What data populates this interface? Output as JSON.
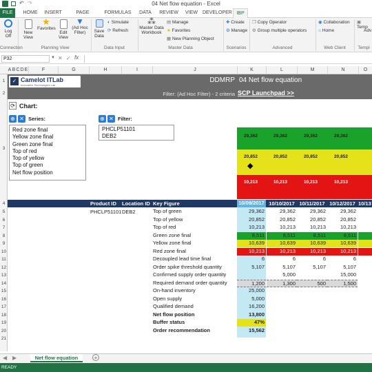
{
  "window": {
    "title": "04 Net flow equation - Excel"
  },
  "ribbon_tabs": [
    "FILE",
    "HOME",
    "INSERT",
    "PAGE LAYOUT",
    "FORMULAS",
    "DATA",
    "REVIEW",
    "VIEW",
    "DEVELOPER",
    "IBP"
  ],
  "ribbon": {
    "log_off": "Log Off",
    "new_view": "New View",
    "favorites": "Favorites",
    "edit_view": "Edit View",
    "ad_hoc": "(Ad Hoc Filter)",
    "save_data": "Save Data",
    "simulate": "Simulate",
    "refresh": "Refresh",
    "master_data_workbook": "Master Data Workbook",
    "manage": "Manage",
    "favorites2": "Favorites",
    "new_planning_object": "New Planning Object",
    "create": "Create",
    "manage2": "Manage",
    "copy_operator": "Copy Operator",
    "group_multiple": "Group multiple operators",
    "collaboration": "Collaboration",
    "home": "Home",
    "templates": "Temp",
    "adv": "Adv",
    "groups": [
      "Connection",
      "Planning View",
      "Data Input",
      "Master Data",
      "Scenarios",
      "Advanced",
      "Web Client",
      "Templ"
    ]
  },
  "formula_bar": {
    "name_box": "P32",
    "fx": "fx",
    "value": ""
  },
  "columns": [
    "A",
    "B",
    "C",
    "D",
    "E",
    "F",
    "G",
    "H",
    "I",
    "J",
    "K",
    "L",
    "M",
    "N",
    "O"
  ],
  "sheet": {
    "logo_name": "Camelot ITLab",
    "logo_sub": "Innovative Technologies Lab",
    "ddmrp": "DDMRP",
    "title": "04 Net flow equation",
    "filter_text": "Filter: (Ad Hoc Filter) - 2 criteria",
    "scp_link": "SCP Launchpad >>",
    "chart_label": "Chart:",
    "series_label": "Series:",
    "filter_label": "Filter:",
    "series_items": [
      "Red zone final",
      "Yellow zone final",
      "Green zone final",
      "Top of red",
      "Top of yellow",
      "Top of green",
      "Net flow position"
    ],
    "filter_items": [
      "PHCLP51101",
      "DEB2"
    ],
    "band_values": {
      "green": "29,362",
      "yellow": "20,852",
      "red": "10,213"
    },
    "header": {
      "product": "Product ID",
      "location": "Location ID",
      "keyfig": "Key Figure",
      "dates": [
        "10/09/2017",
        "10/10/2017",
        "10/11/2017",
        "10/12/2017",
        "10/13"
      ]
    },
    "product_id": "PHCLP51101",
    "location_id": "DEB2",
    "rows": [
      {
        "label": "Top of green",
        "bold": false,
        "vals": [
          "29,362",
          "29,362",
          "29,362",
          "29,362",
          ""
        ]
      },
      {
        "label": "Top of yellow",
        "bold": false,
        "vals": [
          "20,852",
          "20,852",
          "20,852",
          "20,852",
          ""
        ]
      },
      {
        "label": "Top of red",
        "bold": false,
        "vals": [
          "10,213",
          "10,213",
          "10,213",
          "10,213",
          ""
        ]
      },
      {
        "label": "Green zone final",
        "bold": false,
        "vals": [
          "8,511",
          "8,511",
          "8,511",
          "8,511",
          ""
        ]
      },
      {
        "label": "Yellow zone final",
        "bold": false,
        "vals": [
          "10,639",
          "10,639",
          "10,639",
          "10,639",
          ""
        ]
      },
      {
        "label": "Red zone final",
        "bold": false,
        "vals": [
          "10,213",
          "10,213",
          "10,213",
          "10,213",
          ""
        ]
      },
      {
        "label": "Decoupled lead time final",
        "bold": false,
        "vals": [
          "6",
          "6",
          "6",
          "6",
          ""
        ]
      },
      {
        "label": "Order spike threshold quantity",
        "bold": false,
        "vals": [
          "5,107",
          "5,107",
          "5,107",
          "5,107",
          ""
        ]
      },
      {
        "label": "Confirmed supply order quantity",
        "bold": false,
        "vals": [
          "",
          "5,000",
          "",
          "15,000",
          ""
        ]
      },
      {
        "label": "Required demand order quantity",
        "bold": false,
        "vals": [
          "1,200",
          "1,300",
          "500",
          "1,500",
          ""
        ]
      },
      {
        "label": "On-hand inventory",
        "bold": false,
        "vals": [
          "25,000",
          "",
          "",
          "",
          ""
        ]
      },
      {
        "label": "Open supply",
        "bold": false,
        "vals": [
          "5,000",
          "",
          "",
          "",
          ""
        ]
      },
      {
        "label": "Qualified demand",
        "bold": false,
        "vals": [
          "16,200",
          "",
          "",
          "",
          ""
        ]
      },
      {
        "label": "Net flow position",
        "bold": true,
        "vals": [
          "13,800",
          "",
          "",
          "",
          ""
        ]
      },
      {
        "label": "Buffer status",
        "bold": true,
        "vals": [
          "47%",
          "",
          "",
          "",
          ""
        ]
      },
      {
        "label": "Order recommendation",
        "bold": true,
        "vals": [
          "15,562",
          "",
          "",
          "",
          ""
        ]
      }
    ],
    "row_numbers": [
      "1",
      "2",
      "3",
      "4",
      "5",
      "6",
      "7",
      "8",
      "9",
      "10",
      "11",
      "12",
      "13",
      "14",
      "15",
      "16",
      "17",
      "18",
      "19",
      "20",
      "21"
    ]
  },
  "sheet_tab": "Net flow equation",
  "status": "READY",
  "colors": {
    "excel_green": "#217346",
    "header_navy": "#1f3864",
    "band_green": "#1aa32a",
    "band_yellow": "#e5e21a",
    "band_red": "#e31414",
    "date_bg": "#c5e8f5",
    "title_grey": "#6a6a6a"
  }
}
